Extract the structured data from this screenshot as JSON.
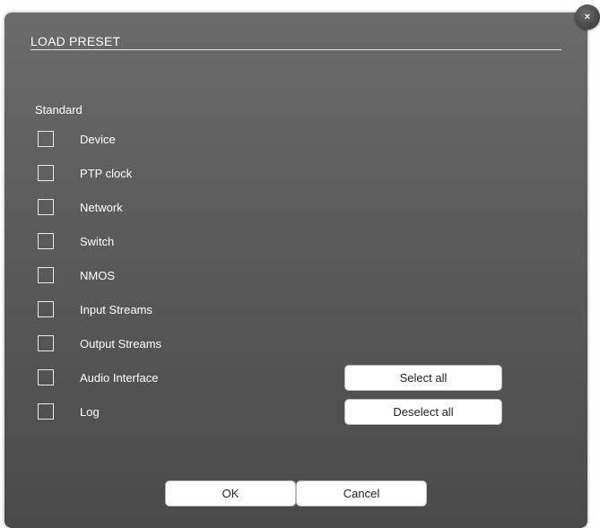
{
  "dialog": {
    "title": "LOAD PRESET",
    "close_glyph": "×",
    "section_label": "Standard",
    "items": [
      {
        "label": "Device",
        "checked": false
      },
      {
        "label": "PTP clock",
        "checked": false
      },
      {
        "label": "Network",
        "checked": false
      },
      {
        "label": "Switch",
        "checked": false
      },
      {
        "label": "NMOS",
        "checked": false
      },
      {
        "label": "Input Streams",
        "checked": false
      },
      {
        "label": "Output Streams",
        "checked": false
      },
      {
        "label": "Audio Interface",
        "checked": false
      },
      {
        "label": "Log",
        "checked": false
      }
    ],
    "select_all_label": "Select all",
    "deselect_all_label": "Deselect all",
    "ok_label": "OK",
    "cancel_label": "Cancel"
  },
  "colors": {
    "dialog_bg_top": "#6b6b6b",
    "dialog_bg_bottom": "#4a4a4a",
    "text": "#ffffff",
    "button_bg": "#ffffff"
  },
  "icons": {
    "close": "close-icon"
  }
}
